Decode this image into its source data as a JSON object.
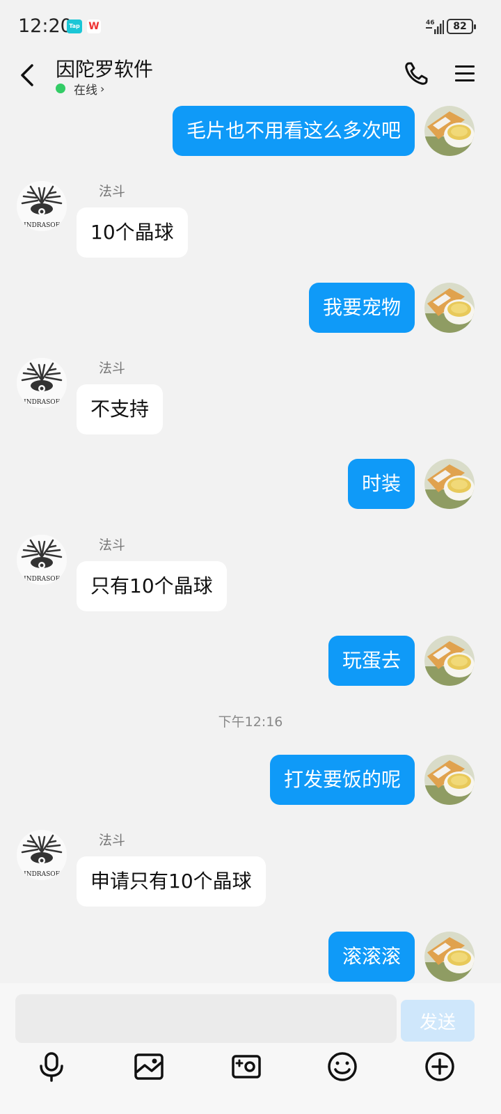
{
  "status_bar": {
    "time": "12:20",
    "network": "4G",
    "battery": "82"
  },
  "header": {
    "title": "因陀罗软件",
    "presence": "在线",
    "presence_color": "#33cc66"
  },
  "colors": {
    "my_bubble": "#0f9af8",
    "their_bubble": "#ffffff",
    "background": "#f2f2f2"
  },
  "messages": [
    {
      "from": "me",
      "text": "毛片也不用看这么多次吧"
    },
    {
      "from": "them",
      "sender": "法斗",
      "text": "10个晶球"
    },
    {
      "from": "me",
      "text": "我要宠物"
    },
    {
      "from": "them",
      "sender": "法斗",
      "text": "不支持"
    },
    {
      "from": "me",
      "text": "时装"
    },
    {
      "from": "them",
      "sender": "法斗",
      "text": "只有10个晶球"
    },
    {
      "from": "me",
      "text": "玩蛋去"
    },
    {
      "timestamp": "下午12:16"
    },
    {
      "from": "me",
      "text": "打发要饭的呢"
    },
    {
      "from": "them",
      "sender": "法斗",
      "text": "申请只有10个晶球"
    },
    {
      "from": "me",
      "text": "滚滚滚"
    }
  ],
  "input": {
    "placeholder": "",
    "send_label": "发送"
  },
  "toolbar": [
    "microphone-icon",
    "image-icon",
    "camera-icon",
    "emoji-icon",
    "plus-icon"
  ]
}
